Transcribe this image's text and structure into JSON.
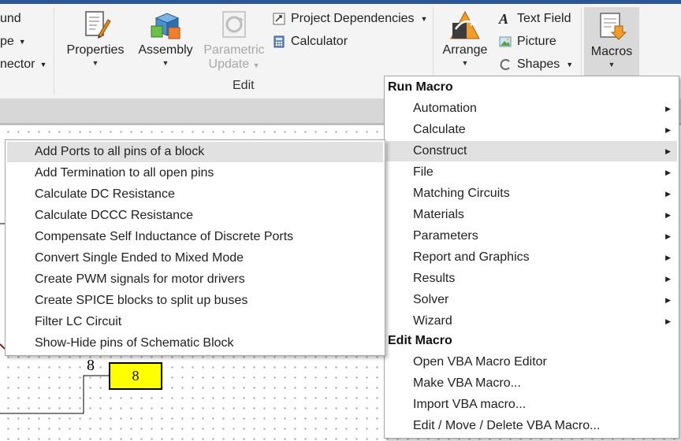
{
  "ribbon": {
    "left_cut": {
      "item1": "und",
      "item2": "pe",
      "item3": "nector"
    },
    "properties": "Properties",
    "assembly": "Assembly",
    "parametric_update_line1": "Parametric",
    "parametric_update_line2": "Update",
    "project_dependencies": "Project Dependencies",
    "calculator": "Calculator",
    "edit_group": "Edit",
    "arrange": "Arrange",
    "text_field": "Text Field",
    "picture": "Picture",
    "shapes": "Shapes",
    "macros": "Macros"
  },
  "macros_menu": {
    "run_header": "Run Macro",
    "run_items": [
      {
        "label": "Automation"
      },
      {
        "label": "Calculate"
      },
      {
        "label": "Construct"
      },
      {
        "label": "File"
      },
      {
        "label": "Matching Circuits"
      },
      {
        "label": "Materials"
      },
      {
        "label": "Parameters"
      },
      {
        "label": "Report and Graphics"
      },
      {
        "label": "Results"
      },
      {
        "label": "Solver"
      },
      {
        "label": "Wizard"
      }
    ],
    "edit_header": "Edit Macro",
    "edit_items": [
      {
        "label": "Open VBA Macro Editor"
      },
      {
        "label": "Make VBA Macro..."
      },
      {
        "label": "Import VBA macro..."
      },
      {
        "label": "Edit / Move / Delete VBA Macro..."
      }
    ],
    "highlighted": "Construct"
  },
  "construct_submenu": {
    "items": [
      {
        "label": "Add Ports to all pins of a block"
      },
      {
        "label": "Add Termination to all open pins"
      },
      {
        "label": "Calculate DC Resistance"
      },
      {
        "label": "Calculate DCCC Resistance"
      },
      {
        "label": "Compensate Self Inductance of Discrete Ports"
      },
      {
        "label": "Convert Single Ended to Mixed Mode"
      },
      {
        "label": "Create PWM signals for motor drivers"
      },
      {
        "label": "Create SPICE blocks to split up buses"
      },
      {
        "label": "Filter LC Circuit"
      },
      {
        "label": "Show-Hide pins of Schematic Block"
      }
    ],
    "highlighted": "Add Ports to all pins of a block"
  },
  "schematic": {
    "port_label": "8",
    "block_label": "8",
    "block_color": "#ffff00"
  },
  "colors": {
    "title_band": "#2b5797",
    "menu_highlight": "#e1e1e1"
  }
}
